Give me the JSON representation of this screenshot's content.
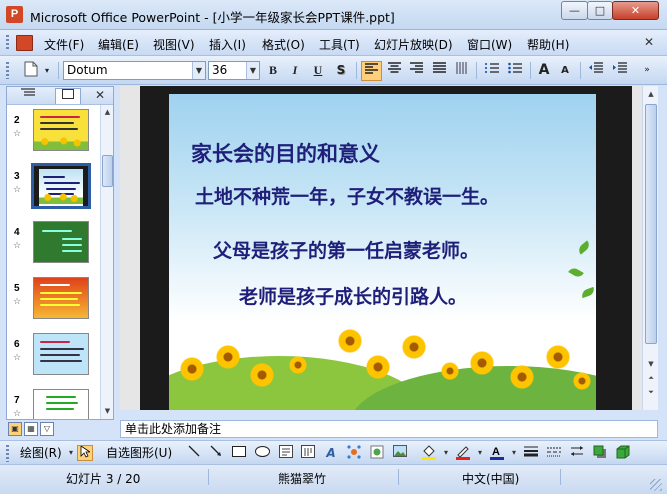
{
  "window": {
    "title": "Microsoft Office PowerPoint - [小学一年级家长会PPT课件.ppt]",
    "app_icon_letter": "P",
    "min_glyph": "—",
    "max_glyph": "□",
    "close_glyph": "✕"
  },
  "menubar": {
    "items": [
      "文件(F)",
      "编辑(E)",
      "视图(V)",
      "插入(I)",
      "格式(O)",
      "工具(T)",
      "幻灯片放映(D)",
      "窗口(W)",
      "帮助(H)"
    ],
    "close_glyph": "✕"
  },
  "toolbar": {
    "font_name": "Dotum",
    "font_size": "36",
    "bold": "B",
    "italic": "I",
    "underline": "U",
    "shadow": "S",
    "increase_font": "A",
    "decrease_font": "A"
  },
  "left_panel": {
    "close_glyph": "✕",
    "slides": [
      {
        "number": "2",
        "selected": false,
        "bg": "#f7e13a"
      },
      {
        "number": "3",
        "selected": true,
        "bg": "#ffffff"
      },
      {
        "number": "4",
        "selected": false,
        "bg": "#2f7a2f"
      },
      {
        "number": "5",
        "selected": false,
        "bg": "#e0421a"
      },
      {
        "number": "6",
        "selected": false,
        "bg": "#bde4f8"
      },
      {
        "number": "7",
        "selected": false,
        "bg": "#ffffff"
      }
    ]
  },
  "slide": {
    "title": "家长会的目的和意义",
    "lines": [
      "土地不种荒一年，子女不教误一生。",
      "父母是孩子的第一任启蒙老师。",
      "老师是孩子成长的引路人。"
    ]
  },
  "notes": {
    "placeholder": "单击此处添加备注"
  },
  "drawbar": {
    "draw_label": "绘图(R)",
    "autoshapes_label": "自选图形(U)"
  },
  "status": {
    "slide_info": "幻灯片 3 / 20",
    "design": "熊猫翠竹",
    "language": "中文(中国)"
  },
  "colors": {
    "slide_text": "#1f1f7a",
    "accent": "#d24726"
  }
}
